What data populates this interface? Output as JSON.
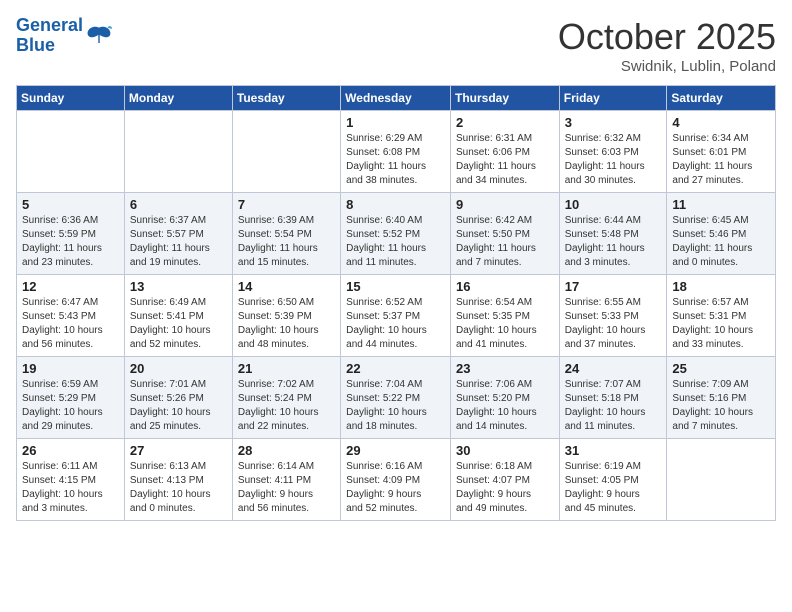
{
  "logo": {
    "line1": "General",
    "line2": "Blue"
  },
  "title": "October 2025",
  "location": "Swidnik, Lublin, Poland",
  "weekdays": [
    "Sunday",
    "Monday",
    "Tuesday",
    "Wednesday",
    "Thursday",
    "Friday",
    "Saturday"
  ],
  "weeks": [
    [
      {
        "day": "",
        "info": ""
      },
      {
        "day": "",
        "info": ""
      },
      {
        "day": "",
        "info": ""
      },
      {
        "day": "1",
        "info": "Sunrise: 6:29 AM\nSunset: 6:08 PM\nDaylight: 11 hours\nand 38 minutes."
      },
      {
        "day": "2",
        "info": "Sunrise: 6:31 AM\nSunset: 6:06 PM\nDaylight: 11 hours\nand 34 minutes."
      },
      {
        "day": "3",
        "info": "Sunrise: 6:32 AM\nSunset: 6:03 PM\nDaylight: 11 hours\nand 30 minutes."
      },
      {
        "day": "4",
        "info": "Sunrise: 6:34 AM\nSunset: 6:01 PM\nDaylight: 11 hours\nand 27 minutes."
      }
    ],
    [
      {
        "day": "5",
        "info": "Sunrise: 6:36 AM\nSunset: 5:59 PM\nDaylight: 11 hours\nand 23 minutes."
      },
      {
        "day": "6",
        "info": "Sunrise: 6:37 AM\nSunset: 5:57 PM\nDaylight: 11 hours\nand 19 minutes."
      },
      {
        "day": "7",
        "info": "Sunrise: 6:39 AM\nSunset: 5:54 PM\nDaylight: 11 hours\nand 15 minutes."
      },
      {
        "day": "8",
        "info": "Sunrise: 6:40 AM\nSunset: 5:52 PM\nDaylight: 11 hours\nand 11 minutes."
      },
      {
        "day": "9",
        "info": "Sunrise: 6:42 AM\nSunset: 5:50 PM\nDaylight: 11 hours\nand 7 minutes."
      },
      {
        "day": "10",
        "info": "Sunrise: 6:44 AM\nSunset: 5:48 PM\nDaylight: 11 hours\nand 3 minutes."
      },
      {
        "day": "11",
        "info": "Sunrise: 6:45 AM\nSunset: 5:46 PM\nDaylight: 11 hours\nand 0 minutes."
      }
    ],
    [
      {
        "day": "12",
        "info": "Sunrise: 6:47 AM\nSunset: 5:43 PM\nDaylight: 10 hours\nand 56 minutes."
      },
      {
        "day": "13",
        "info": "Sunrise: 6:49 AM\nSunset: 5:41 PM\nDaylight: 10 hours\nand 52 minutes."
      },
      {
        "day": "14",
        "info": "Sunrise: 6:50 AM\nSunset: 5:39 PM\nDaylight: 10 hours\nand 48 minutes."
      },
      {
        "day": "15",
        "info": "Sunrise: 6:52 AM\nSunset: 5:37 PM\nDaylight: 10 hours\nand 44 minutes."
      },
      {
        "day": "16",
        "info": "Sunrise: 6:54 AM\nSunset: 5:35 PM\nDaylight: 10 hours\nand 41 minutes."
      },
      {
        "day": "17",
        "info": "Sunrise: 6:55 AM\nSunset: 5:33 PM\nDaylight: 10 hours\nand 37 minutes."
      },
      {
        "day": "18",
        "info": "Sunrise: 6:57 AM\nSunset: 5:31 PM\nDaylight: 10 hours\nand 33 minutes."
      }
    ],
    [
      {
        "day": "19",
        "info": "Sunrise: 6:59 AM\nSunset: 5:29 PM\nDaylight: 10 hours\nand 29 minutes."
      },
      {
        "day": "20",
        "info": "Sunrise: 7:01 AM\nSunset: 5:26 PM\nDaylight: 10 hours\nand 25 minutes."
      },
      {
        "day": "21",
        "info": "Sunrise: 7:02 AM\nSunset: 5:24 PM\nDaylight: 10 hours\nand 22 minutes."
      },
      {
        "day": "22",
        "info": "Sunrise: 7:04 AM\nSunset: 5:22 PM\nDaylight: 10 hours\nand 18 minutes."
      },
      {
        "day": "23",
        "info": "Sunrise: 7:06 AM\nSunset: 5:20 PM\nDaylight: 10 hours\nand 14 minutes."
      },
      {
        "day": "24",
        "info": "Sunrise: 7:07 AM\nSunset: 5:18 PM\nDaylight: 10 hours\nand 11 minutes."
      },
      {
        "day": "25",
        "info": "Sunrise: 7:09 AM\nSunset: 5:16 PM\nDaylight: 10 hours\nand 7 minutes."
      }
    ],
    [
      {
        "day": "26",
        "info": "Sunrise: 6:11 AM\nSunset: 4:15 PM\nDaylight: 10 hours\nand 3 minutes."
      },
      {
        "day": "27",
        "info": "Sunrise: 6:13 AM\nSunset: 4:13 PM\nDaylight: 10 hours\nand 0 minutes."
      },
      {
        "day": "28",
        "info": "Sunrise: 6:14 AM\nSunset: 4:11 PM\nDaylight: 9 hours\nand 56 minutes."
      },
      {
        "day": "29",
        "info": "Sunrise: 6:16 AM\nSunset: 4:09 PM\nDaylight: 9 hours\nand 52 minutes."
      },
      {
        "day": "30",
        "info": "Sunrise: 6:18 AM\nSunset: 4:07 PM\nDaylight: 9 hours\nand 49 minutes."
      },
      {
        "day": "31",
        "info": "Sunrise: 6:19 AM\nSunset: 4:05 PM\nDaylight: 9 hours\nand 45 minutes."
      },
      {
        "day": "",
        "info": ""
      }
    ]
  ]
}
